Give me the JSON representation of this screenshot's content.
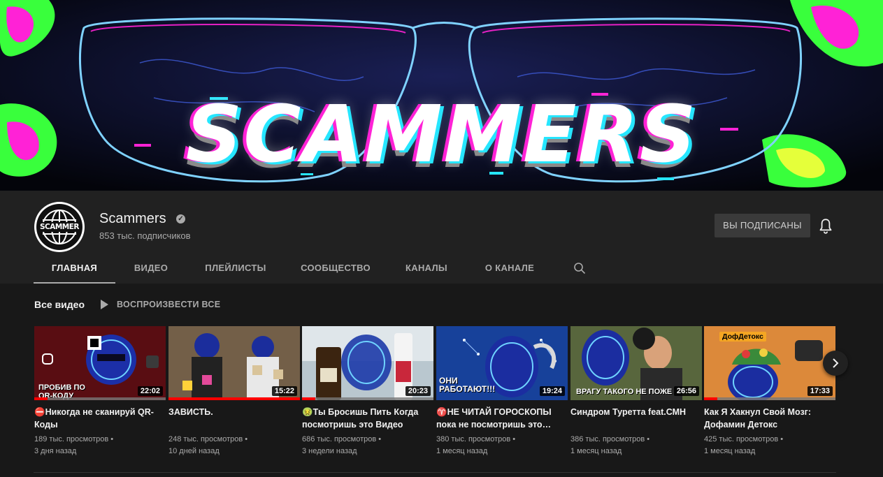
{
  "banner": {
    "title": "SCAMMERS"
  },
  "channel": {
    "name": "Scammers",
    "subscribers": "853 тыс. подписчиков",
    "avatar_text": "SCAMMER",
    "subscribe_label": "ВЫ ПОДПИСАНЫ"
  },
  "tabs": [
    "ГЛАВНАЯ",
    "ВИДЕО",
    "ПЛЕЙЛИСТЫ",
    "СООБЩЕСТВО",
    "КАНАЛЫ",
    "О КАНАЛЕ"
  ],
  "shelf": {
    "title": "Все видео",
    "play_all": "ВОСПРОИЗВЕСТИ ВСЕ"
  },
  "videos": [
    {
      "title": "⛔Никогда не сканируй QR-Коды",
      "views": "189 тыс. просмотров •",
      "age": "3 дня назад",
      "duration": "22:02",
      "overlay": "ПРОБИВ ПО QR-КОДУ",
      "progress": 0.1
    },
    {
      "title": "ЗАВИСТЬ.",
      "views": "248 тыс. просмотров •",
      "age": "10 дней назад",
      "duration": "15:22",
      "overlay": "",
      "progress": 1.0
    },
    {
      "title": "🤢Ты Бросишь Пить Когда посмотришь это Видео",
      "views": "686 тыс. просмотров •",
      "age": "3 недели назад",
      "duration": "20:23",
      "overlay": "",
      "progress": 0.1
    },
    {
      "title": "♈НЕ ЧИТАЙ ГОРОСКОПЫ пока не посмотришь это…",
      "views": "380 тыс. просмотров •",
      "age": "1 месяц назад",
      "duration": "19:24",
      "overlay": "ОНИ РАБОТАЮТ!!!",
      "progress": 0.0
    },
    {
      "title": "Синдром Туретта feat.СМН",
      "views": "386 тыс. просмотров •",
      "age": "1 месяц назад",
      "duration": "26:56",
      "overlay": "ВРАГУ ТАКОГО НЕ ПОЖЕ",
      "progress": 0.0
    },
    {
      "title": "Как Я Хакнул Свой Мозг: Дофамин Детокс",
      "views": "425 тыс. просмотров •",
      "age": "1 месяц назад",
      "duration": "17:33",
      "overlay": "ДофДетокс",
      "progress": 0.1
    }
  ],
  "colors": {
    "background": "#181818",
    "header": "#212121",
    "accent_red": "#ff0000",
    "neon_pink": "#ff22d6",
    "neon_cyan": "#26e6ff",
    "neon_green": "#39ff3c"
  },
  "icons": [
    "verified-icon",
    "bell-icon",
    "search-icon",
    "play-icon",
    "chevron-right-icon"
  ]
}
